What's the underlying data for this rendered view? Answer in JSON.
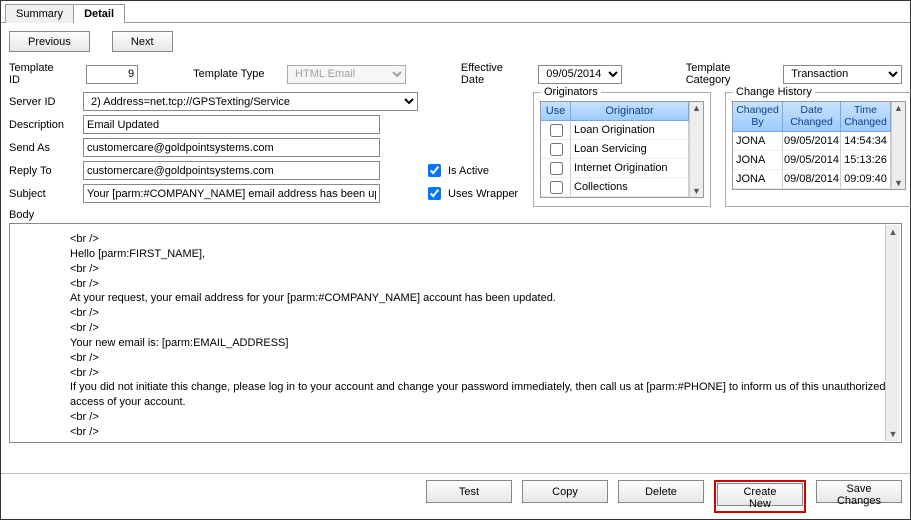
{
  "tabs": {
    "summary": "Summary",
    "detail": "Detail"
  },
  "nav": {
    "prev": "Previous",
    "next": "Next"
  },
  "labels": {
    "template_id": "Template ID",
    "template_type": "Template Type",
    "effective_date": "Effective Date",
    "template_category": "Template Category",
    "server_id": "Server ID",
    "description": "Description",
    "send_as": "Send As",
    "reply_to": "Reply To",
    "subject": "Subject",
    "is_active": "Is Active",
    "uses_wrapper": "Uses Wrapper",
    "body": "Body"
  },
  "values": {
    "template_id": "9",
    "template_type": "HTML Email",
    "effective_date": "09/05/2014",
    "template_category": "Transaction",
    "server_id": "2) Address=net.tcp://GPSTexting/Service",
    "description": "Email Updated",
    "send_as": "customercare@goldpointsystems.com",
    "reply_to": "customercare@goldpointsystems.com",
    "subject": "Your [parm:#COMPANY_NAME] email address has been upda",
    "is_active": true,
    "uses_wrapper": true
  },
  "originators": {
    "legend": "Originators",
    "headers": {
      "use": "Use",
      "originator": "Originator"
    },
    "rows": [
      {
        "name": "Loan Origination"
      },
      {
        "name": "Loan Servicing"
      },
      {
        "name": "Internet Origination"
      },
      {
        "name": "Collections"
      }
    ]
  },
  "history": {
    "legend": "Change History",
    "headers": {
      "by": "Changed\nBy",
      "date": "Date\nChanged",
      "time": "Time\nChanged"
    },
    "rows": [
      {
        "by": "JONA",
        "date": "09/05/2014",
        "time": "14:54:34"
      },
      {
        "by": "JONA",
        "date": "09/05/2014",
        "time": "15:13:26"
      },
      {
        "by": "JONA",
        "date": "09/08/2014",
        "time": "09:09:40"
      }
    ]
  },
  "body_text": "<br />\nHello [parm:FIRST_NAME],\n<br />\n<br />\nAt your request, your email address for your [parm:#COMPANY_NAME] account has been updated.\n<br />\n<br />\nYour new email is: [parm:EMAIL_ADDRESS]\n<br />\n<br />\nIf you did not initiate this change, please log in to your account and change your password immediately, then call us at [parm:#PHONE] to inform us of this unauthorized access of your account.\n<br />\n<br />\nThank you,\n<br />",
  "footer": {
    "test": "Test",
    "copy": "Copy",
    "delete": "Delete",
    "create_new": "Create New",
    "save_changes": "Save Changes"
  }
}
